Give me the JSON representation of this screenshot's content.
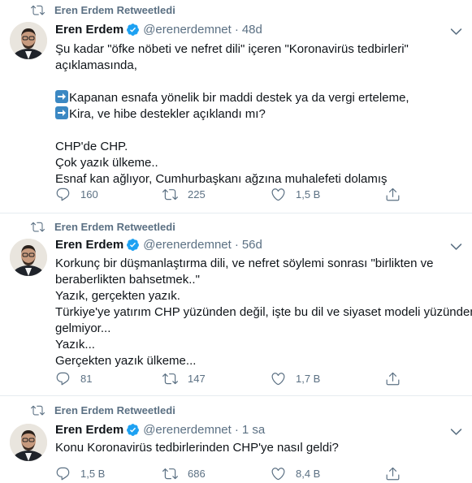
{
  "tweets": [
    {
      "retweet_label": "Eren Erdem Retweetledi",
      "name": "Eren Erdem",
      "handle": "@erenerdemnet",
      "time": "48d",
      "lines": [
        "Şu kadar \"öfke nöbeti ve nefret dili\" içeren \"Koronavirüs tedbirleri\"",
        "açıklamasında,",
        "",
        "Kapanan esnafa yönelik bir maddi destek ya da vergi erteleme,",
        "Kira, ve hibe destekler açıklandı mı?",
        "",
        "CHP'de CHP.",
        "Çok yazık ülkeme..",
        "Esnaf kan ağlıyor, Cumhurbaşkanı ağzına muhalefeti dolamış"
      ],
      "replies": "160",
      "retweets": "225",
      "likes": "1,5 B"
    },
    {
      "retweet_label": "Eren Erdem Retweetledi",
      "name": "Eren Erdem",
      "handle": "@erenerdemnet",
      "time": "56d",
      "lines": [
        "Korkunç bir düşmanlaştırma dili, ve nefret söylemi sonrası \"birlikten ve",
        "beraberlikten bahsetmek..\"",
        "Yazık, gerçekten yazık.",
        "Türkiye'ye yatırım CHP yüzünden değil, işte bu dil ve siyaset modeli yüzünden",
        "gelmiyor...",
        "Yazık...",
        "Gerçekten yazık ülkeme..."
      ],
      "replies": "81",
      "retweets": "147",
      "likes": "1,7 B"
    },
    {
      "retweet_label": "Eren Erdem Retweetledi",
      "name": "Eren Erdem",
      "handle": "@erenerdemnet",
      "time": "1 sa",
      "lines": [
        "Konu Koronavirüs tedbirlerinden CHP'ye nasıl geldi?"
      ],
      "replies": "1,5 B",
      "retweets": "686",
      "likes": "8,4 B"
    }
  ],
  "icons": {
    "retweeted": "retweet-icon",
    "verified": "verified-badge-icon",
    "more": "chevron-down-icon",
    "reply": "reply-icon",
    "retweet": "retweet-icon",
    "like": "heart-icon",
    "share": "share-icon",
    "arrow": "right-arrow-emoji"
  },
  "colors": {
    "secondary_text": "#5b7083",
    "verified_blue": "#1da1f2",
    "divider": "#e6ecf0",
    "arrow_emoji": "#3b88c3"
  }
}
